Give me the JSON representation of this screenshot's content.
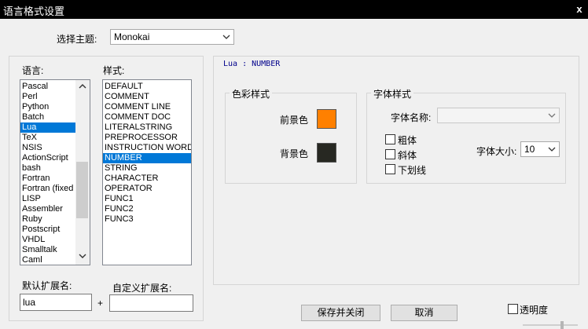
{
  "window": {
    "title": "语言格式设置",
    "close_glyph": "x"
  },
  "theme": {
    "label": "选择主题:",
    "value": "Monokai"
  },
  "languages": {
    "label": "语言:",
    "items": [
      "Pascal",
      "Perl",
      "Python",
      "Batch",
      "Lua",
      "TeX",
      "NSIS",
      "ActionScript",
      "bash",
      "Fortran",
      "Fortran (fixed",
      "LISP",
      "Assembler",
      "Ruby",
      "Postscript",
      "VHDL",
      "Smalltalk",
      "Caml"
    ],
    "selected_index": 4
  },
  "styles": {
    "label": "样式:",
    "items": [
      "DEFAULT",
      "COMMENT",
      "COMMENT LINE",
      "COMMENT DOC",
      "LITERALSTRING",
      "PREPROCESSOR",
      "INSTRUCTION WORD",
      "NUMBER",
      "STRING",
      "CHARACTER",
      "OPERATOR",
      "FUNC1",
      "FUNC2",
      "FUNC3"
    ],
    "selected_index": 7
  },
  "preview": {
    "text": "Lua : NUMBER"
  },
  "color_group": {
    "title": "色彩样式",
    "foreground_label": "前景色",
    "foreground_color": "#ff8000",
    "background_label": "背景色",
    "background_color": "#272822"
  },
  "font_group": {
    "title": "字体样式",
    "name_label": "字体名称:",
    "name_value": "",
    "bold_label": "粗体",
    "italic_label": "斜体",
    "underline_label": "下划线",
    "size_label": "字体大小:",
    "size_value": "10"
  },
  "extensions": {
    "default_label": "默认扩展名:",
    "default_value": "lua",
    "plus": "+",
    "custom_label": "自定义扩展名:",
    "custom_value": ""
  },
  "buttons": {
    "save_close": "保存并关闭",
    "cancel": "取消"
  },
  "transparency": {
    "label": "透明度",
    "checked": false
  },
  "colors": {
    "selection": "#0078d7",
    "titlebar": "#000000"
  }
}
